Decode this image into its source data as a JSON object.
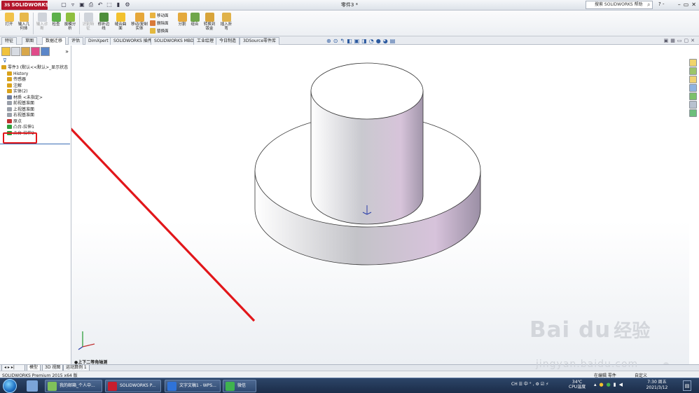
{
  "app": {
    "logo": "SOLIDWORKS",
    "doc_title": "零件3 *",
    "search_placeholder": "搜索 SOLIDWORKS 帮助",
    "help": "? -",
    "colors": {
      "brand": "#b3162b",
      "accent": "#e2161a",
      "part": "#d8d2e2"
    }
  },
  "ribbon": {
    "buttons": [
      {
        "label": "打开",
        "icon": "open-icon"
      },
      {
        "label": "输入几何体",
        "icon": "import-geometry-icon"
      },
      {
        "label": "输入诊断",
        "icon": "import-diagnostics-icon"
      },
      {
        "label": "检查",
        "icon": "check-icon"
      },
      {
        "label": "拔模分析",
        "icon": "draft-analysis-icon"
      },
      {
        "label": "识别特征",
        "icon": "feature-recognition-icon"
      },
      {
        "label": "修补边线",
        "icon": "repair-edges-icon"
      },
      {
        "label": "缝合曲面",
        "icon": "knit-surface-icon"
      },
      {
        "label": "移动/复制实体",
        "icon": "move-copy-body-icon"
      }
    ],
    "small": [
      "移动面",
      "删除面",
      "替换面"
    ],
    "buttons2": [
      {
        "label": "分割",
        "icon": "split-icon"
      },
      {
        "label": "组合",
        "icon": "combine-icon"
      },
      {
        "label": "转换到钣金",
        "icon": "convert-sheet-metal-icon"
      },
      {
        "label": "插入折弯",
        "icon": "insert-bends-icon"
      }
    ]
  },
  "tabs": [
    "特征",
    "草图",
    "数据迁移",
    "评估",
    "DimXpert",
    "SOLIDWORKS 插件",
    "SOLIDWORKS MBD",
    "工业绘理",
    "今日制造",
    "3DSource零件库"
  ],
  "tree": [
    {
      "label": "零件3 (默认<<默认>_显示状态",
      "indent": 0,
      "color": "#d9a21b"
    },
    {
      "label": "History",
      "indent": 1,
      "color": "#d9a21b"
    },
    {
      "label": "传感器",
      "indent": 1,
      "color": "#d9a21b"
    },
    {
      "label": "注解",
      "indent": 1,
      "color": "#d9a21b"
    },
    {
      "label": "实体(2)",
      "indent": 1,
      "color": "#d9a21b"
    },
    {
      "label": "材质 <未指定>",
      "indent": 1,
      "color": "#6f7fa0"
    },
    {
      "label": "前视基准面",
      "indent": 1,
      "color": "#9aa0aa"
    },
    {
      "label": "上视基准面",
      "indent": 1,
      "color": "#9aa0aa"
    },
    {
      "label": "右视基准面",
      "indent": 1,
      "color": "#9aa0aa"
    },
    {
      "label": "原点",
      "indent": 1,
      "color": "#c03030"
    },
    {
      "label": "凸台-拉伸1",
      "indent": 1,
      "color": "#2f9e3c"
    },
    {
      "label": "凸台-拉伸2",
      "indent": 1,
      "color": "#2f9e3c"
    }
  ],
  "viewport": {
    "view_name": "●上下二等角轴测"
  },
  "bottom_tabs": [
    "模型",
    "3D 视图",
    "运动算例 1"
  ],
  "status": {
    "left": "SOLIDWORKS Premium 2015 x64 版",
    "mid": "在编辑 零件",
    "edit": "自定义"
  },
  "taskbar": {
    "tasks": [
      "我的邮箱_个人中...",
      "SOLIDWORKS P...",
      "文字文稿1 - WPS...",
      "微信"
    ],
    "tray": "CH ☰ 中 ° , ⚙ ☑ ⚡",
    "temp": "34℃",
    "temp_label": "CPU温度",
    "time": "7:30 周五",
    "date": "2021/3/12"
  },
  "watermark": {
    "brand": "Bai du",
    "cn": "经验",
    "url": "jingyan.baidu.com"
  }
}
